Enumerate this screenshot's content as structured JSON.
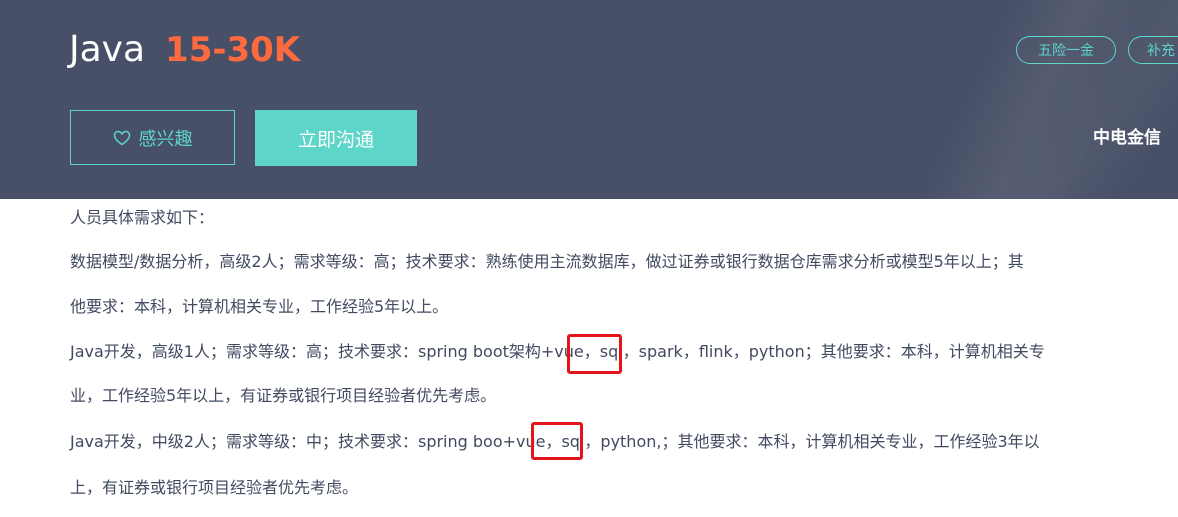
{
  "job": {
    "title": "Java",
    "salary": "15-30K"
  },
  "tags": [
    "五险一金",
    "补充"
  ],
  "buttons": {
    "interest_label": "感兴趣",
    "chat_label": "立即沟通"
  },
  "company": {
    "name": "中电金信"
  },
  "description": {
    "lines": [
      "人员具体需求如下：",
      "数据模型/数据分析，高级2人；需求等级：高；技术要求：熟练使用主流数据库，做过证券或银行数据仓库需求分析或模型5年以上；其",
      "他要求：本科，计算机相关专业，工作经验5年以上。",
      "Java开发，高级1人；需求等级：高；技术要求：spring boot架构+vue，sql，spark，flink，python；其他要求：本科，计算机相关专",
      "业，工作经验5年以上，有证券或银行项目经验者优先考虑。",
      "Java开发，中级2人；需求等级：中；技术要求：spring boo+vue，sql，python,；其他要求：本科，计算机相关专业，工作经验3年以",
      "上，有证券或银行项目经验者优先考虑。"
    ]
  },
  "colors": {
    "header_bg": "#485067",
    "accent": "#5dd5c8",
    "salary": "#fe6a3f",
    "annotation": "#e3151b",
    "body_text": "#414a60"
  },
  "icons": {
    "interest": "heart-outline-icon"
  }
}
